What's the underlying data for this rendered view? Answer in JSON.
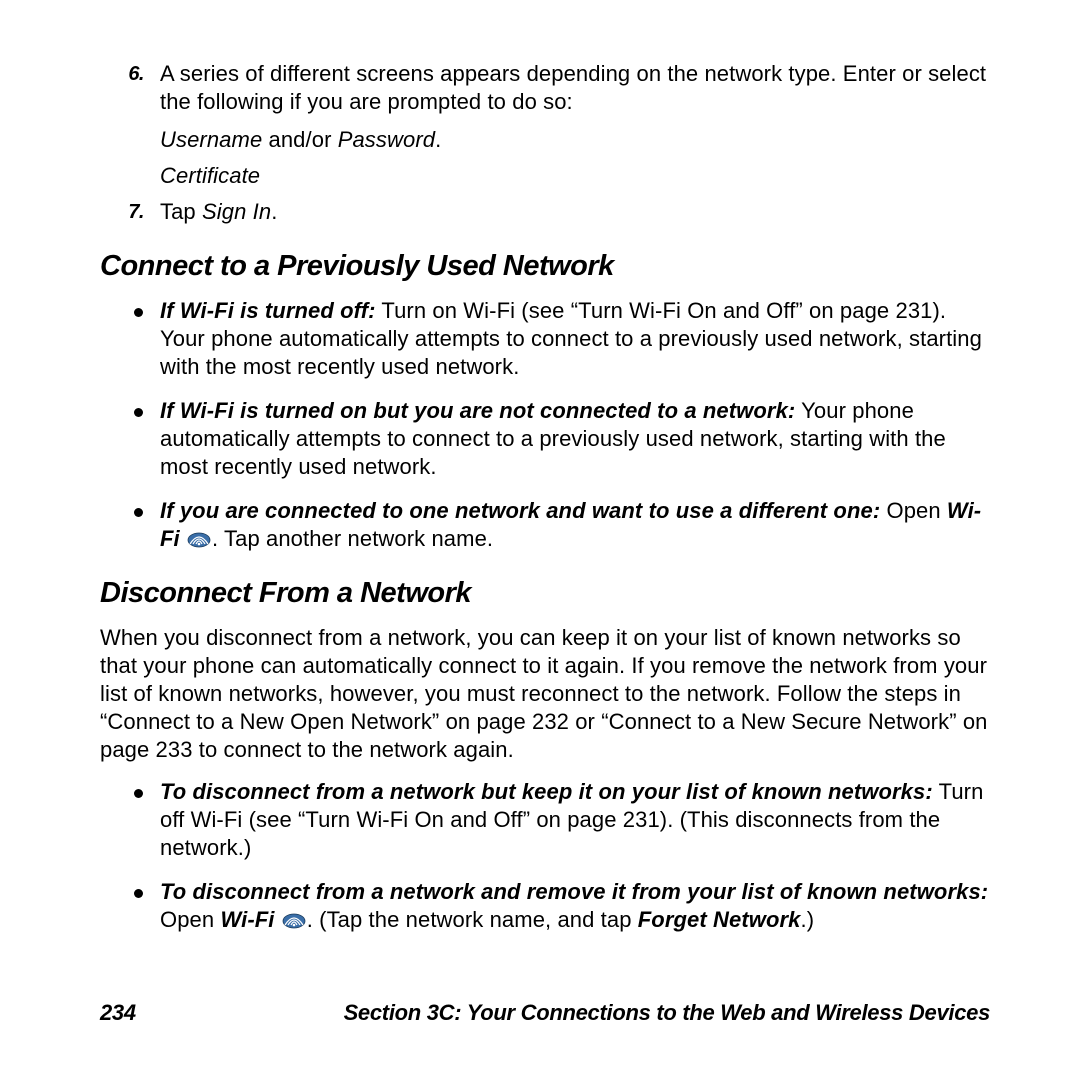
{
  "step6": {
    "num": "6.",
    "text_a": "A series of different screens appears depending on the network type. Enter or select the following if you are prompted to do so:",
    "sub1_a": "Username",
    "sub1_b": " and/or ",
    "sub1_c": "Password",
    "sub1_d": ".",
    "sub2": "Certificate"
  },
  "step7": {
    "num": "7.",
    "text_a": "Tap ",
    "text_b": "Sign In",
    "text_c": "."
  },
  "sectionA": {
    "title": "Connect to a Previously Used Network",
    "b1_a": "If Wi-Fi is turned off:",
    "b1_b": " Turn on Wi-Fi (see “Turn Wi-Fi On and Off” on page 231). Your phone automatically attempts to connect to a previously used network, starting with the most recently used network.",
    "b2_a": "If Wi-Fi is turned on but you are not connected to a network:",
    "b2_b": " Your phone automatically attempts to connect to a previously used network, starting with the most recently used network.",
    "b3_a": "If you are connected to one network and want to use a different one:",
    "b3_b": " Open ",
    "b3_c": "Wi-Fi",
    "b3_d": " ",
    "b3_e": ". Tap another network name."
  },
  "sectionB": {
    "title": "Disconnect From a Network",
    "para": "When you disconnect from a network, you can keep it on your list of known networks so that your phone can automatically connect to it again. If you remove the network from your list of known networks, however, you must reconnect to the network. Follow the steps in “Connect to a New Open Network” on page 232 or “Connect to a New Secure Network” on page 233 to connect to the network again.",
    "b1_a": "To disconnect from a network but keep it on your list of known networks:",
    "b1_b": " Turn off Wi-Fi (see “Turn Wi-Fi On and Off” on page 231). (This disconnects from the network.)",
    "b2_a": "To disconnect from a network and remove it from your list of known networks:",
    "b2_b": " Open ",
    "b2_c": "Wi-Fi",
    "b2_d": " ",
    "b2_e": ". (Tap the network name, and tap ",
    "b2_f": "Forget Network",
    "b2_g": ".)"
  },
  "footer": {
    "page": "234",
    "section": "Section 3C: Your Connections to the Web and Wireless Devices"
  },
  "icons": {
    "wifi": "wifi-icon"
  }
}
